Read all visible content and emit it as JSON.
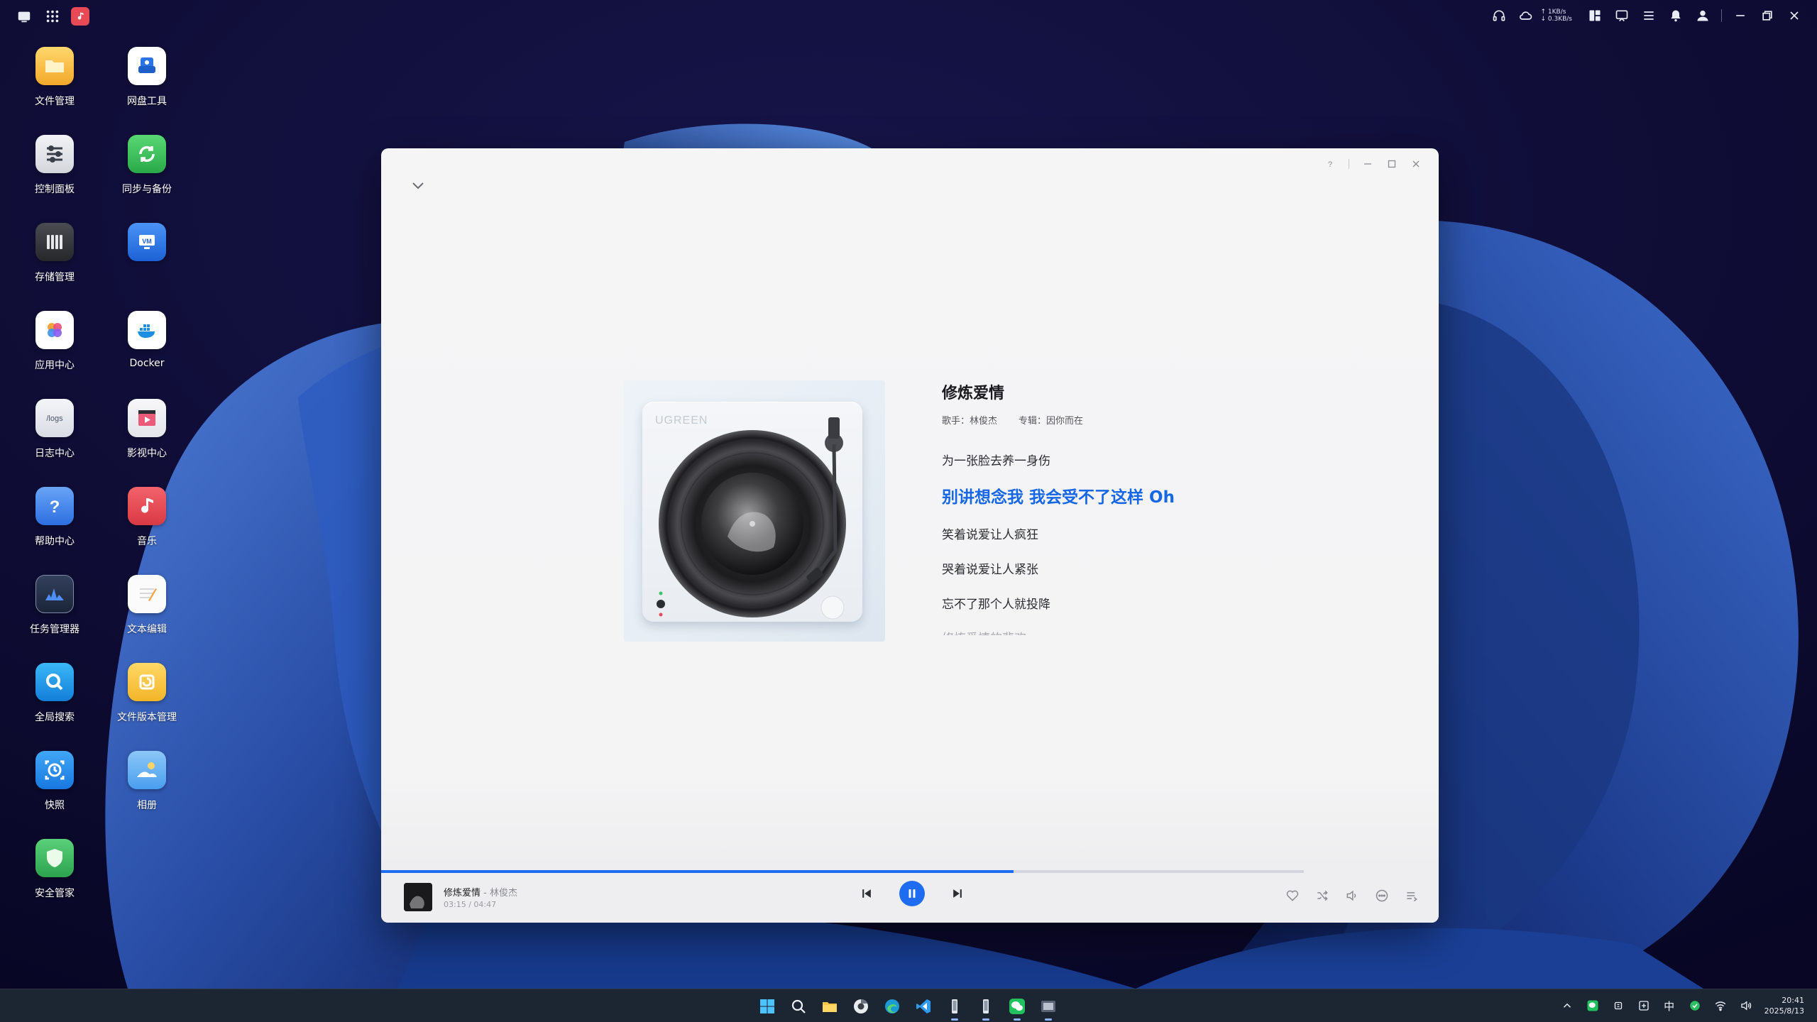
{
  "topbar": {
    "left_icons": [
      "window-switch-icon",
      "app-grid-icon",
      "music-app-icon"
    ],
    "net_up": "↑ 1KB/s",
    "net_down": "↓ 0.3KB/s",
    "right_icons": [
      "headset-icon",
      "cloud-sync-icon",
      "widget-icon",
      "message-icon",
      "settings-list-icon",
      "bell-icon",
      "user-icon",
      "minimize-icon",
      "restore-icon",
      "close-icon"
    ]
  },
  "desktop": {
    "apps": [
      {
        "label": "文件管理",
        "icon": "folder-icon",
        "color": "#f2b73a"
      },
      {
        "label": "网盘工具",
        "icon": "cloud-drive-icon",
        "color": "#ffffff"
      },
      {
        "label": "控制面板",
        "icon": "control-panel-icon",
        "color": "#e7e8ec"
      },
      {
        "label": "同步与备份",
        "icon": "sync-icon",
        "color": "#3fbf5a"
      },
      {
        "label": "存储管理",
        "icon": "storage-icon",
        "color": "#3a3b40"
      },
      {
        "label": "",
        "icon": "vm-icon",
        "color": "#2f7be6"
      },
      {
        "label": "应用中心",
        "icon": "app-center-icon",
        "color": "#ffffff"
      },
      {
        "label": "Docker",
        "icon": "docker-icon",
        "color": "#ffffff"
      },
      {
        "label": "日志中心",
        "icon": "logs-icon",
        "color": "#e8eaf0"
      },
      {
        "label": "影视中心",
        "icon": "video-center-icon",
        "color": "#f2f2f4"
      },
      {
        "label": "帮助中心",
        "icon": "help-icon",
        "color": "#4a8cf0"
      },
      {
        "label": "音乐",
        "icon": "music-icon",
        "color": "#ec4e57"
      },
      {
        "label": "任务管理器",
        "icon": "task-manager-icon",
        "color": "#25314a"
      },
      {
        "label": "文本编辑",
        "icon": "text-editor-icon",
        "color": "#f6f6f8"
      },
      {
        "label": "全局搜索",
        "icon": "global-search-icon",
        "color": "#1e9df0"
      },
      {
        "label": "文件版本管理",
        "icon": "file-version-icon",
        "color": "#f2c440"
      },
      {
        "label": "快照",
        "icon": "snapshot-icon",
        "color": "#2591ee"
      },
      {
        "label": "相册",
        "icon": "photo-album-icon",
        "color": "#6ab6f5"
      },
      {
        "label": "安全管家",
        "icon": "security-icon",
        "color": "#3dbb5c"
      }
    ]
  },
  "player": {
    "song_title": "修炼爱情",
    "artist_label": "歌手：",
    "artist": "林俊杰",
    "album_label": "专辑：",
    "album": "因你而在",
    "art_brand": "UGREEN",
    "lyrics": [
      "为一张脸去养一身伤",
      "别讲想念我 我会受不了这样 Oh",
      "笑着说爱让人疯狂",
      "哭着说爱让人紧张",
      "忘不了那个人就投降",
      "修炼爱情的悲欢"
    ],
    "active_lyric_index": 1,
    "progress": 0.685,
    "now_playing_title": "修炼爱情",
    "now_playing_artist": " - 林俊杰",
    "time_display": "03:15 / 04:47",
    "accent_color": "#1e6df0"
  },
  "taskbar": {
    "apps": [
      "windows-start-icon",
      "search-icon",
      "file-explorer-icon",
      "chrome-icon",
      "edge-icon",
      "vscode-icon",
      "phone-icon",
      "phone-icon-2",
      "wechat-icon",
      "nas-client-icon"
    ],
    "tray_ime": "中",
    "time": "20:41",
    "date": "2025/8/13"
  }
}
